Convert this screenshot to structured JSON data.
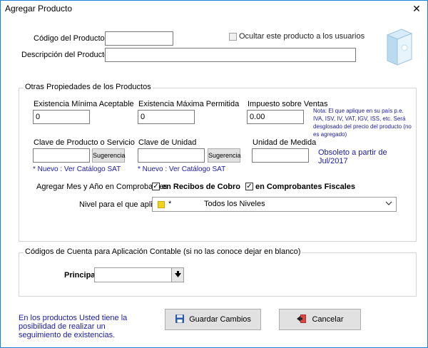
{
  "window": {
    "title": "Agregar Producto",
    "close_glyph": "✕"
  },
  "product": {
    "code_label": "Código del Producto",
    "code_value": "",
    "hide_label": "Ocultar este producto a los usuarios",
    "hide_checked": false,
    "desc_label": "Descripción del Producto",
    "desc_value": ""
  },
  "props": {
    "group_title": "Otras Propiedades de los Productos",
    "min_label": "Existencia Mínima Aceptable",
    "min_value": "0",
    "max_label": "Existencia Máxima Permitida",
    "max_value": "0",
    "tax_label": "Impuesto sobre Ventas",
    "tax_value": "0.00",
    "tax_note": "Nota: El que aplique en su país p.e. IVA, ISV, IV, VAT, IGV, ISS, etc. Será desglosado del precio del producto (no es agregado)",
    "sat_code_label": "Clave de Producto o Servicio",
    "sat_code_value": "",
    "suggest_label": "Sugerencia",
    "sat_link": "* Nuevo : Ver Catálogo SAT",
    "unit_key_label": "Clave de Unidad",
    "unit_key_value": "",
    "unit_suggest_label": "Sugerencia",
    "unit_sat_link": "* Nuevo : Ver Catálogo SAT",
    "uom_label": "Unidad de Medida",
    "uom_value": "",
    "obsolete_note": "Obsoleto a partir de Jul/2017",
    "add_month_label": "Agregar Mes y Año en Comprobantes",
    "receipts_label": "en Recibos de Cobro",
    "receipts_checked": true,
    "fiscal_label": "en Comprobantes Fiscales",
    "fiscal_checked": true,
    "level_label": "Nivel para el que aplica",
    "level_star": "*",
    "level_value": "Todos los Niveles",
    "level_color": "#f2d21b"
  },
  "accounts": {
    "group_title": "Códigos de Cuenta para Aplicación Contable  (si no las conoce dejar en blanco)",
    "main_label": "Principal",
    "main_value": ""
  },
  "footer": {
    "info": "En los productos Usted tiene la posibilidad de realizar un seguimiento de existencias.",
    "save_label": "Guardar Cambios",
    "cancel_label": "Cancelar"
  }
}
